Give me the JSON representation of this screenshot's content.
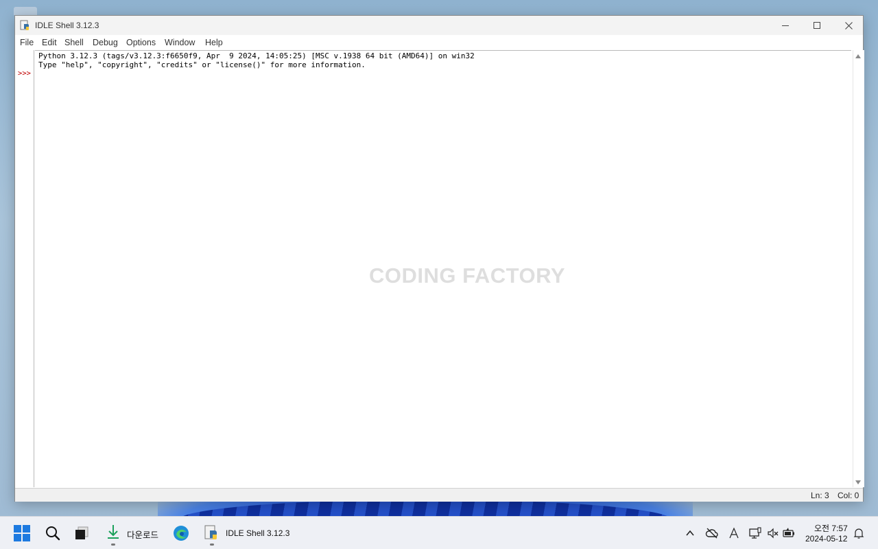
{
  "window": {
    "title": "IDLE Shell 3.12.3"
  },
  "menubar": {
    "items": [
      "File",
      "Edit",
      "Shell",
      "Debug",
      "Options",
      "Window",
      "Help"
    ]
  },
  "editor": {
    "lines": [
      "Python 3.12.3 (tags/v3.12.3:f6650f9, Apr  9 2024, 14:05:25) [MSC v.1938 64 bit (AMD64)] on win32",
      "Type \"help\", \"copyright\", \"credits\" or \"license()\" for more information."
    ],
    "prompt": ">>>"
  },
  "watermark": "CODING FACTORY",
  "statusbar": {
    "line": "Ln: 3",
    "column": "Col: 0"
  },
  "taskbar": {
    "download_label": "다운로드",
    "idle_label": "IDLE Shell 3.12.3",
    "clock_time": "오전 7:57",
    "clock_date": "2024-05-12"
  },
  "colors": {
    "prompt": "#c00000",
    "accent": "#1d7ae0"
  },
  "icons": [
    "python-icon",
    "minimize-icon",
    "maximize-icon",
    "close-icon",
    "scroll-up-icon",
    "scroll-down-icon",
    "start-icon",
    "search-icon",
    "task-view-icon",
    "download-icon",
    "edge-icon",
    "chevron-up-icon",
    "cloud-off-icon",
    "font-icon",
    "network-icon",
    "volume-mute-icon",
    "battery-icon",
    "notification-bell-icon"
  ]
}
